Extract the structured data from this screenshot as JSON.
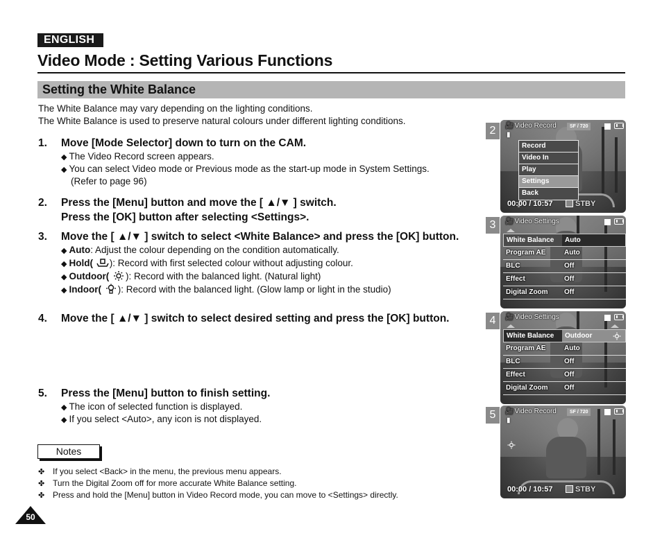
{
  "language_badge": "ENGLISH",
  "page_title": "Video Mode : Setting Various Functions",
  "section_title": "Setting the White Balance",
  "intro": [
    "The White Balance may vary depending on the lighting conditions.",
    "The White Balance is used to preserve natural colours under different lighting conditions."
  ],
  "steps": [
    {
      "num": "1.",
      "text": "Move [Mode Selector] down to turn on the CAM.",
      "bullets": [
        "The Video Record screen appears.",
        "You can select Video mode or Previous mode as the start-up mode in System Settings.",
        "(Refer to page 96)"
      ]
    },
    {
      "num": "2.",
      "text": "Press the [Menu] button and move the [ ▲/▼ ] switch.",
      "text2": "Press the [OK] button after selecting <Settings>."
    },
    {
      "num": "3.",
      "text": "Move the [ ▲/▼ ] switch to select <White Balance> and press the [OK] button.",
      "options": [
        {
          "name": "Auto",
          "icon": "",
          "desc": ": Adjust the colour depending on the condition automatically."
        },
        {
          "name": "Hold(",
          "icon": "hold-icon",
          "desc": "): Record with first selected colour without adjusting colour."
        },
        {
          "name": "Outdoor(",
          "icon": "outdoor-sun-icon",
          "desc": "): Record with the balanced light. (Natural light)"
        },
        {
          "name": "Indoor(",
          "icon": "indoor-bulb-icon",
          "desc": "): Record with the balanced light. (Glow lamp or light in the studio)"
        }
      ]
    },
    {
      "num": "4.",
      "text": "Move the [ ▲/▼ ] switch to select desired setting and press the [OK] button."
    },
    {
      "num": "5.",
      "text": "Press the [Menu] button to finish setting.",
      "bullets": [
        "The icon of selected function is displayed.",
        "If you select <Auto>, any icon is not displayed."
      ]
    }
  ],
  "notes_label": "Notes",
  "notes": [
    "If you select <Back> in the menu, the previous menu appears.",
    "Turn the Digital Zoom off for more accurate White Balance setting.",
    "Press and hold the [Menu] button in Video Record mode, you can move to <Settings> directly."
  ],
  "page_number": "50",
  "bullet_glyph": "◆",
  "note_glyph": "✤",
  "screens": [
    {
      "num": "2",
      "title": "Video Record",
      "quality": "SF",
      "resolution": "720",
      "time": "00:00 / 10:57",
      "status": "STBY",
      "menu": [
        "Record",
        "Video In",
        "Play",
        "Settings",
        "Back"
      ],
      "selected_index": 3
    },
    {
      "num": "3",
      "title": "Video Settings",
      "rows": [
        {
          "label": "White Balance",
          "value": "Auto"
        },
        {
          "label": "Program AE",
          "value": "Auto"
        },
        {
          "label": "BLC",
          "value": "Off"
        },
        {
          "label": "Effect",
          "value": "Off"
        },
        {
          "label": "Digital Zoom",
          "value": "Off"
        }
      ]
    },
    {
      "num": "4",
      "title": "Video Settings",
      "rows": [
        {
          "label": "White Balance",
          "value": "Outdoor"
        },
        {
          "label": "Program AE",
          "value": "Auto"
        },
        {
          "label": "BLC",
          "value": "Off"
        },
        {
          "label": "Effect",
          "value": "Off"
        },
        {
          "label": "Digital Zoom",
          "value": "Off"
        }
      ]
    },
    {
      "num": "5",
      "title": "Video Record",
      "quality": "SF",
      "resolution": "720",
      "time": "00:00 / 10:57",
      "status": "STBY",
      "wb_icon": "outdoor-sun-icon"
    }
  ]
}
